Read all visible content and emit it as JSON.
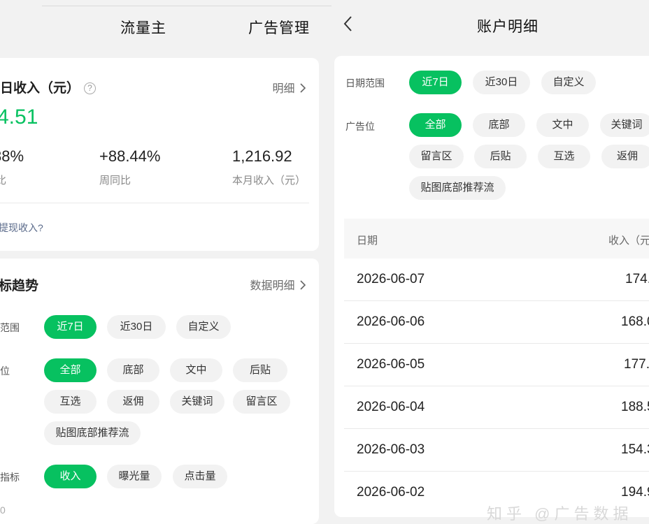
{
  "left": {
    "tabs": [
      "流量主",
      "广告管理"
    ],
    "revenue_card": {
      "title": "日收入（元）",
      "detail_link": "明细",
      "today_value": "4.51",
      "stats": [
        {
          "value": "88%",
          "label": "比"
        },
        {
          "value": "+88.44%",
          "label": "周同比"
        },
        {
          "value": "1,216.92",
          "label": "本月收入（元）"
        }
      ],
      "question": "提现收入?"
    },
    "trend_card": {
      "title": "标趋势",
      "detail_link": "数据明细",
      "date_label": "范围",
      "date_chips": [
        "近7日",
        "近30日",
        "自定义"
      ],
      "ad_label": "位",
      "ad_chips": [
        "全部",
        "底部",
        "文中",
        "后贴",
        "互选",
        "返佣",
        "关键词",
        "留言区",
        "贴图底部推荐流"
      ],
      "metric_label": "指标",
      "metric_chips": [
        "收入",
        "曝光量",
        "点击量"
      ],
      "axis_zero": "0"
    }
  },
  "right": {
    "title": "账户明细",
    "date_label": "日期范围",
    "date_chips": [
      "近7日",
      "近30日",
      "自定义"
    ],
    "ad_label": "广告位",
    "ad_chips": [
      "全部",
      "底部",
      "文中",
      "关键词",
      "留言区",
      "后贴",
      "互选",
      "返佣",
      "贴图底部推荐流"
    ],
    "table": {
      "headers": [
        "日期",
        "收入（元"
      ],
      "rows": [
        {
          "date": "2026-06-07",
          "income": "174."
        },
        {
          "date": "2026-06-06",
          "income": "168.0"
        },
        {
          "date": "2026-06-05",
          "income": "177.7"
        },
        {
          "date": "2026-06-04",
          "income": "188.5"
        },
        {
          "date": "2026-06-03",
          "income": "154.3"
        },
        {
          "date": "2026-06-02",
          "income": "194.9"
        }
      ]
    },
    "watermark": "知乎 @广告数据"
  },
  "colors": {
    "accent": "#07c160",
    "background": "#f2f2f2"
  }
}
